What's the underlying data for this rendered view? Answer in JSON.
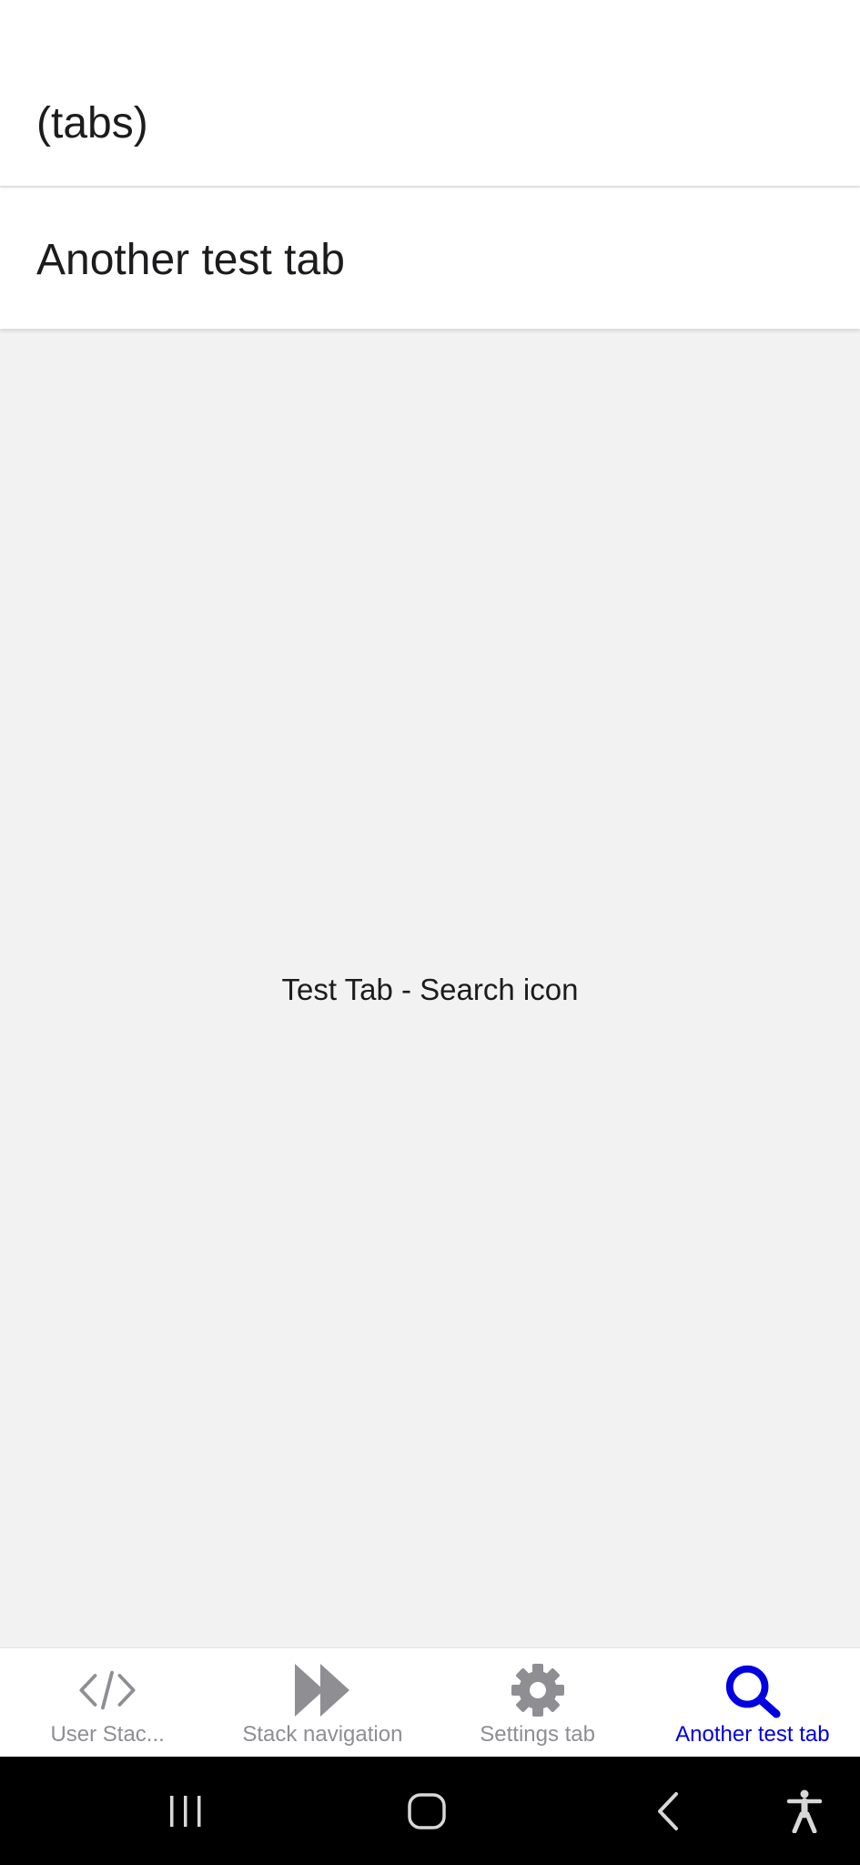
{
  "app": {
    "outer_title": "(tabs)",
    "screen_title": "Another test tab"
  },
  "content": {
    "text": "Test Tab - Search icon"
  },
  "tabbar": {
    "tabs": [
      {
        "label": "User Stac...",
        "icon": "code-icon",
        "active": false
      },
      {
        "label": "Stack navigation",
        "icon": "fast-forward-icon",
        "active": false
      },
      {
        "label": "Settings tab",
        "icon": "gear-icon",
        "active": false
      },
      {
        "label": "Another test tab",
        "icon": "search-icon",
        "active": true
      }
    ],
    "inactive_color": "#8e8e93",
    "active_color": "#0000e0"
  },
  "system_nav": {
    "buttons": [
      "recent-apps-icon",
      "home-icon",
      "back-icon",
      "accessibility-icon"
    ],
    "background": "#000000"
  }
}
